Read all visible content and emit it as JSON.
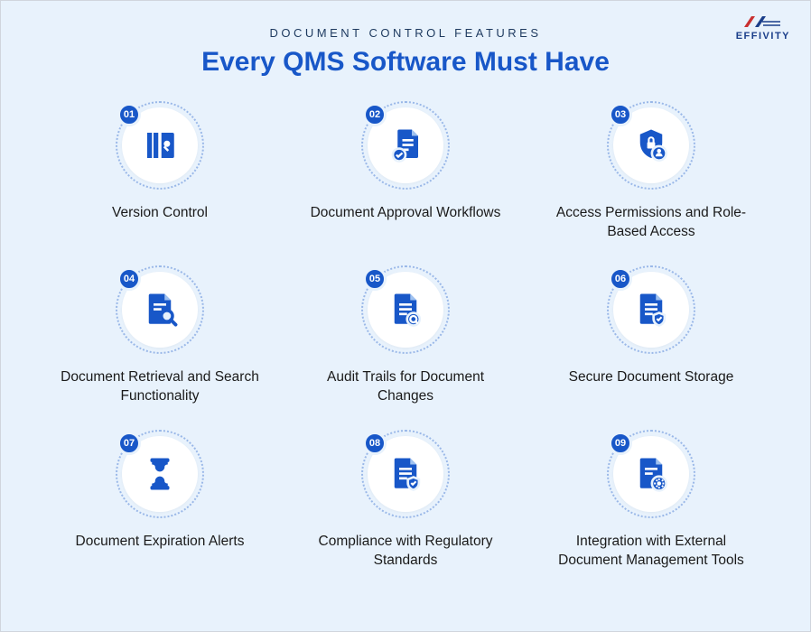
{
  "brand": "EFFIVITY",
  "overline": "DOCUMENT CONTROL FEATURES",
  "title": "Every QMS Software Must Have",
  "features": [
    {
      "num": "01",
      "label": "Version Control"
    },
    {
      "num": "02",
      "label": "Document Approval Workflows"
    },
    {
      "num": "03",
      "label": "Access Permissions and Role-Based Access"
    },
    {
      "num": "04",
      "label": "Document Retrieval and Search Functionality"
    },
    {
      "num": "05",
      "label": "Audit Trails for Document Changes"
    },
    {
      "num": "06",
      "label": "Secure Document Storage"
    },
    {
      "num": "07",
      "label": "Document Expiration Alerts"
    },
    {
      "num": "08",
      "label": "Compliance with Regulatory Standards"
    },
    {
      "num": "09",
      "label": "Integration with External Document Management Tools"
    }
  ]
}
